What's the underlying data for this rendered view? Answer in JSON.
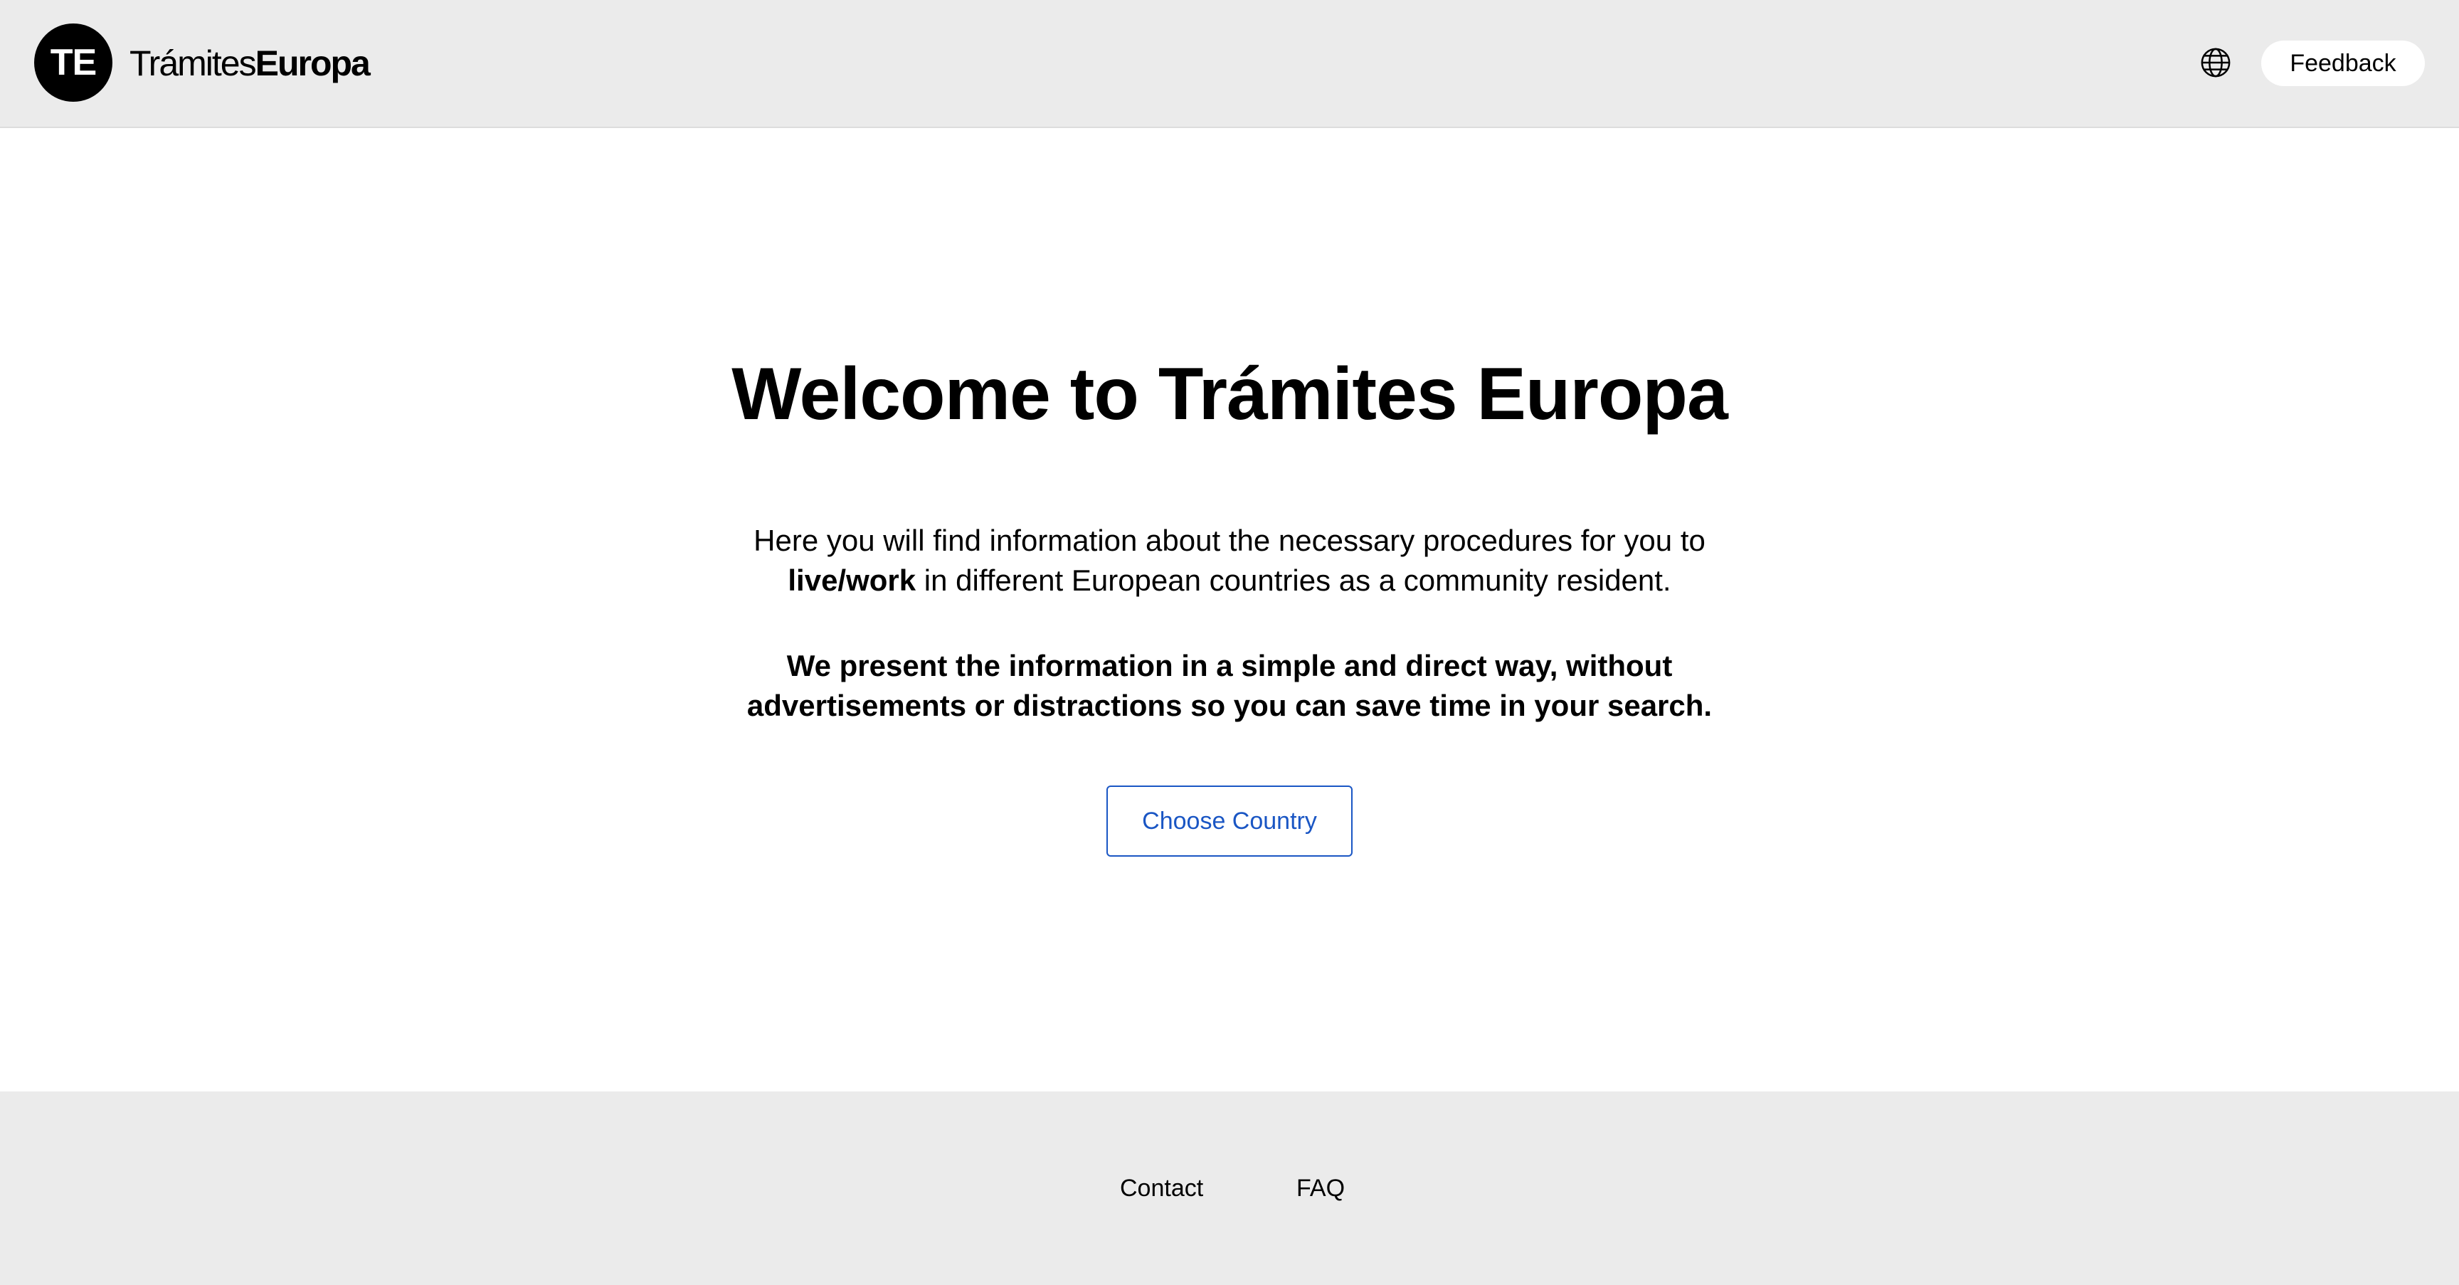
{
  "header": {
    "logo_initials": "TE",
    "brand_light": "Trámites",
    "brand_bold": "Europa",
    "language_icon": "globe-icon",
    "feedback_label": "Feedback"
  },
  "main": {
    "title": "Welcome to Trámites Europa",
    "intro_part1": "Here you will find information about the necessary procedures for you to ",
    "intro_bold": "live/work",
    "intro_part2": " in different European countries as a community resident.",
    "highlight": "We present the information in a simple and direct way, without advertisements or distractions so you can save time in your search.",
    "choose_country_label": "Choose Country"
  },
  "footer": {
    "links": [
      {
        "label": "Contact"
      },
      {
        "label": "FAQ"
      }
    ]
  },
  "colors": {
    "header_bg": "#ebebeb",
    "footer_bg": "#ebebeb",
    "accent": "#1a56c4",
    "logo_bg": "#000000"
  }
}
